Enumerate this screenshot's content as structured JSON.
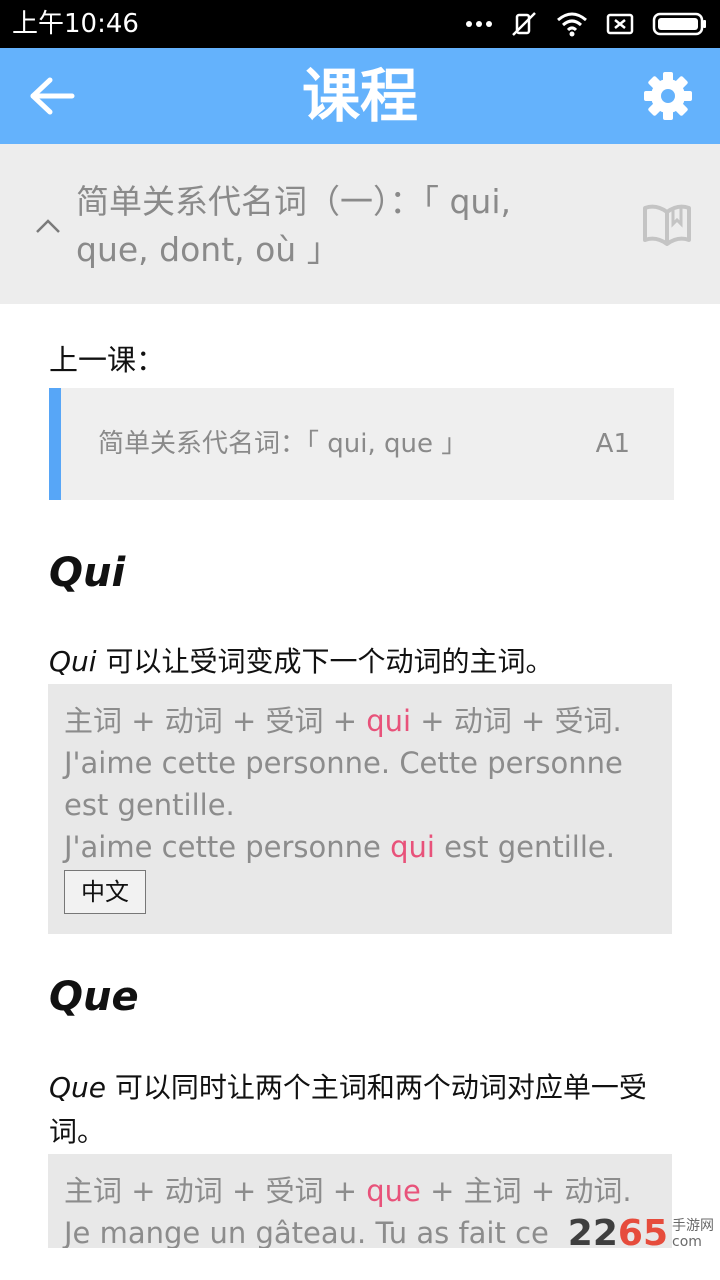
{
  "status_bar": {
    "time": "上午10:46",
    "icons": [
      "more-icon",
      "mute-icon",
      "wifi-icon",
      "sim-off-icon",
      "battery-icon"
    ]
  },
  "app_bar": {
    "title": "课程",
    "back_icon": "arrow-left-icon",
    "settings_icon": "gear-icon",
    "color": "#64b2fc"
  },
  "lesson": {
    "title_line1": "简单关系代名词（一）：「 qui,",
    "title_line2": "que, dont, où 」"
  },
  "previous": {
    "label": "上一课：",
    "title": "简单关系代名词：「 qui, que 」",
    "level": "A1"
  },
  "sections": [
    {
      "heading": "Qui",
      "desc_term": "Qui",
      "desc_text": " 可以让受词变成下一个动词的主词。",
      "formula_before": "主词 + 动词 + 受词 + ",
      "formula_highlight": "qui",
      "formula_after": " + 动词 + 受词.",
      "example1": "J'aime cette personne. Cette personne est gentille.",
      "example2_before": "J'aime cette personne ",
      "example2_highlight": "qui",
      "example2_after": " est gentille.",
      "translate_label": "中文"
    },
    {
      "heading": "Que",
      "desc_term": "Que",
      "desc_text": " 可以同时让两个主词和两个动词对应单一受词。",
      "formula_before": "主词 + 动词 + 受词 + ",
      "formula_highlight": "que",
      "formula_after": " + 主词 + 动词.",
      "example1": "Je mange un gâteau. Tu as fait ce gâteau."
    }
  ],
  "watermark": {
    "brand_main": "22",
    "brand_accent": "65",
    "sub1": "手游网",
    "sub2": "com"
  },
  "colors": {
    "highlight": "#e8527a",
    "accent_bar": "#57a6f7"
  }
}
